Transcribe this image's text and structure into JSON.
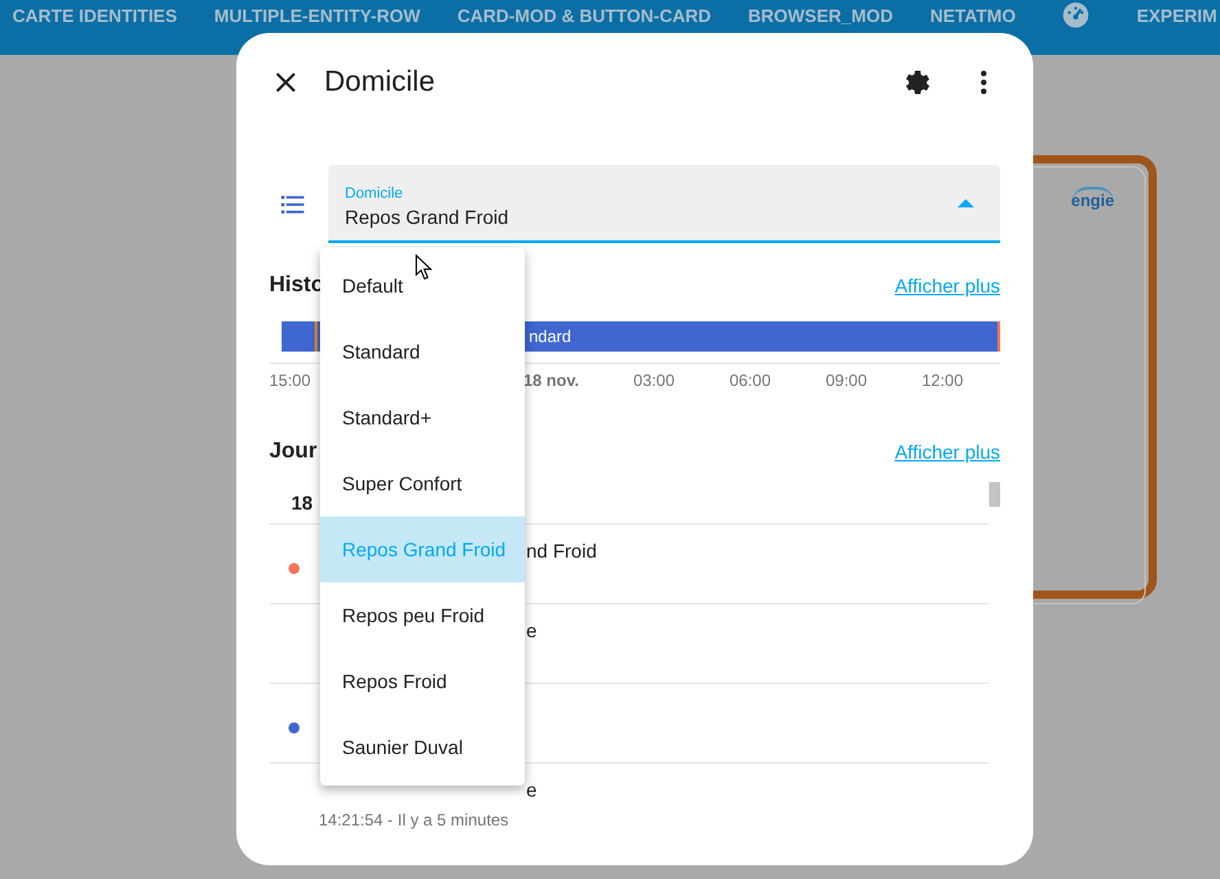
{
  "top_bar": {
    "tabs": [
      {
        "kind": "text",
        "label": "CARTE IDENTITIES"
      },
      {
        "kind": "text",
        "label": "MULTIPLE-ENTITY-ROW"
      },
      {
        "kind": "text",
        "label": "CARD-MOD & BUTTON-CARD"
      },
      {
        "kind": "text",
        "label": "BROWSER_MOD"
      },
      {
        "kind": "text",
        "label": "NETATMO"
      },
      {
        "kind": "icon"
      },
      {
        "kind": "text",
        "label": "EXPERIM"
      }
    ]
  },
  "background_card": {
    "logo": "engie"
  },
  "dialog": {
    "title": "Domicile",
    "select": {
      "label": "Domicile",
      "value": "Repos Grand Froid",
      "expanded": true,
      "options": [
        {
          "label": "Default",
          "selected": false
        },
        {
          "label": "Standard",
          "selected": false
        },
        {
          "label": "Standard+",
          "selected": false
        },
        {
          "label": "Super Confort",
          "selected": false
        },
        {
          "label": "Repos Grand Froid",
          "selected": true
        },
        {
          "label": "Repos peu Froid",
          "selected": false
        },
        {
          "label": "Repos Froid",
          "selected": false
        },
        {
          "label": "Saunier Duval",
          "selected": false
        }
      ]
    },
    "history": {
      "title": "Histo",
      "link": "Afficher plus",
      "segment_label": "ndard",
      "axis_labels": [
        {
          "label": "15:00",
          "bold": false
        },
        {
          "label": "18 nov.",
          "bold": true
        },
        {
          "label": "03:00",
          "bold": false
        },
        {
          "label": "06:00",
          "bold": false
        },
        {
          "label": "09:00",
          "bold": false
        },
        {
          "label": "12:00",
          "bold": false
        }
      ]
    },
    "logbook": {
      "title": "Jour",
      "link": "Afficher plus",
      "date": "18",
      "entries": [
        {
          "color": "#f4735b",
          "text": "nd Froid"
        },
        {
          "text": "e"
        },
        {
          "color": "#3f66d1"
        },
        {
          "text": "e",
          "time": "14:21:54 - Il y a 5 minutes"
        }
      ]
    }
  }
}
